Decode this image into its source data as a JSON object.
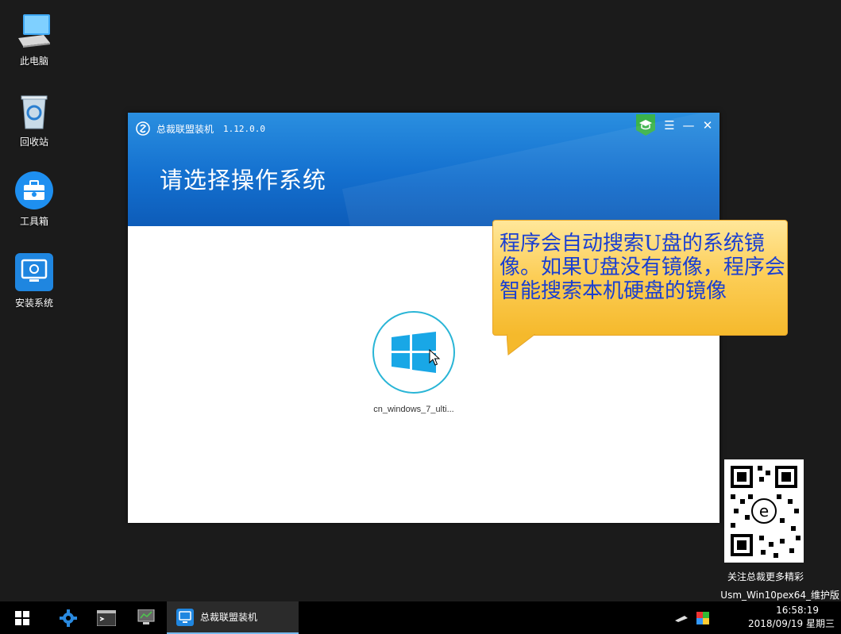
{
  "desktop": {
    "icons": [
      {
        "label": "此电脑",
        "icon": "computer-icon"
      },
      {
        "label": "回收站",
        "icon": "recycle-bin-icon"
      },
      {
        "label": "工具箱",
        "icon": "toolbox-icon"
      },
      {
        "label": "安装系统",
        "icon": "install-system-icon"
      }
    ]
  },
  "window": {
    "app_name": "总裁联盟装机",
    "version": "1.12.0.0",
    "heading": "请选择操作系统",
    "accent": "#1470cf",
    "os_items": [
      {
        "label": "cn_windows_7_ulti...",
        "icon": "windows-logo-icon"
      }
    ]
  },
  "callout": {
    "text": "程序会自动搜索U盘的系统镜像。如果U盘没有镜像，程序会智能搜索本机硬盘的镜像"
  },
  "watermark": {
    "qr_caption": "关注总裁更多精彩",
    "edition": "Usm_Win10pex64_维护版"
  },
  "taskbar": {
    "active_app": "总裁联盟装机",
    "time": "16:58:19",
    "date": "2018/09/19 星期三"
  }
}
